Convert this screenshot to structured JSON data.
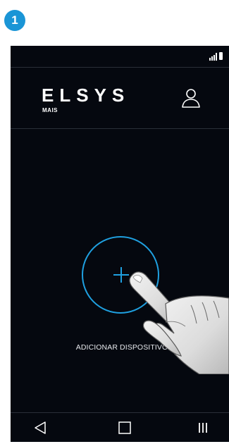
{
  "step": {
    "number": "1"
  },
  "header": {
    "logo_text": "ELSYS",
    "logo_subtext": "MAIS"
  },
  "main": {
    "add_device_label": "ADICIONAR DISPOSITIVO"
  },
  "icons": {
    "status": [
      "signal-icon",
      "battery-icon"
    ],
    "header": [
      "user-icon"
    ],
    "main": [
      "plus-icon",
      "hand-pointer-icon"
    ],
    "navigation": [
      "back-icon",
      "home-icon",
      "recent-apps-icon"
    ]
  },
  "colors": {
    "accent": "#1fa0e0",
    "badge": "#1a95d6",
    "background": "#05080f",
    "text": "#ffffff"
  }
}
